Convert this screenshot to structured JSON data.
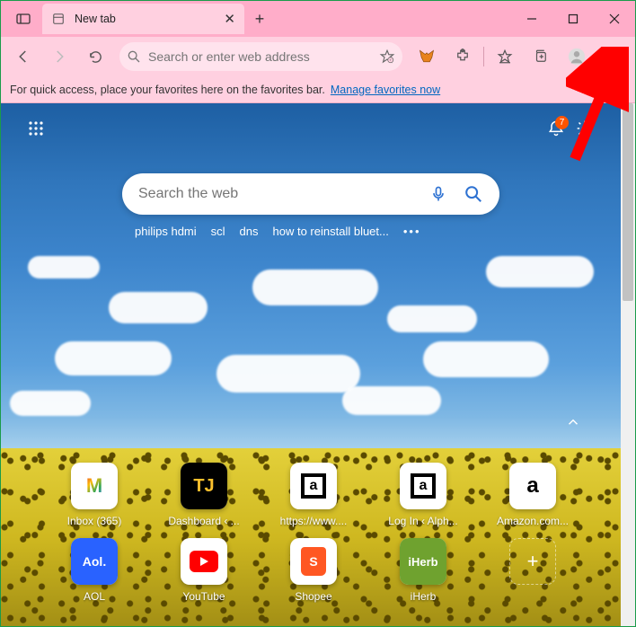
{
  "titlebar": {
    "tab_title": "New tab"
  },
  "toolbar": {
    "search_placeholder": "Search or enter web address"
  },
  "favbar": {
    "text": "For quick access, place your favorites here on the favorites bar.",
    "link": "Manage favorites now"
  },
  "content": {
    "notification_count": "7",
    "search_placeholder": "Search the web",
    "suggestions": [
      "philips hdmi",
      "scl",
      "dns",
      "how to reinstall bluet..."
    ],
    "quick_links_row1": [
      {
        "label": "Inbox (365)",
        "kind": "gmail"
      },
      {
        "label": "Dashboard ‹ ...",
        "kind": "tj"
      },
      {
        "label": "https://www....",
        "kind": "sq"
      },
      {
        "label": "Log In ‹ Alph...",
        "kind": "sq"
      },
      {
        "label": "Amazon.com...",
        "kind": "amz"
      }
    ],
    "quick_links_row2": [
      {
        "label": "AOL",
        "kind": "aol"
      },
      {
        "label": "YouTube",
        "kind": "yt"
      },
      {
        "label": "Shopee",
        "kind": "shopee"
      },
      {
        "label": "iHerb",
        "kind": "iherb"
      }
    ]
  }
}
